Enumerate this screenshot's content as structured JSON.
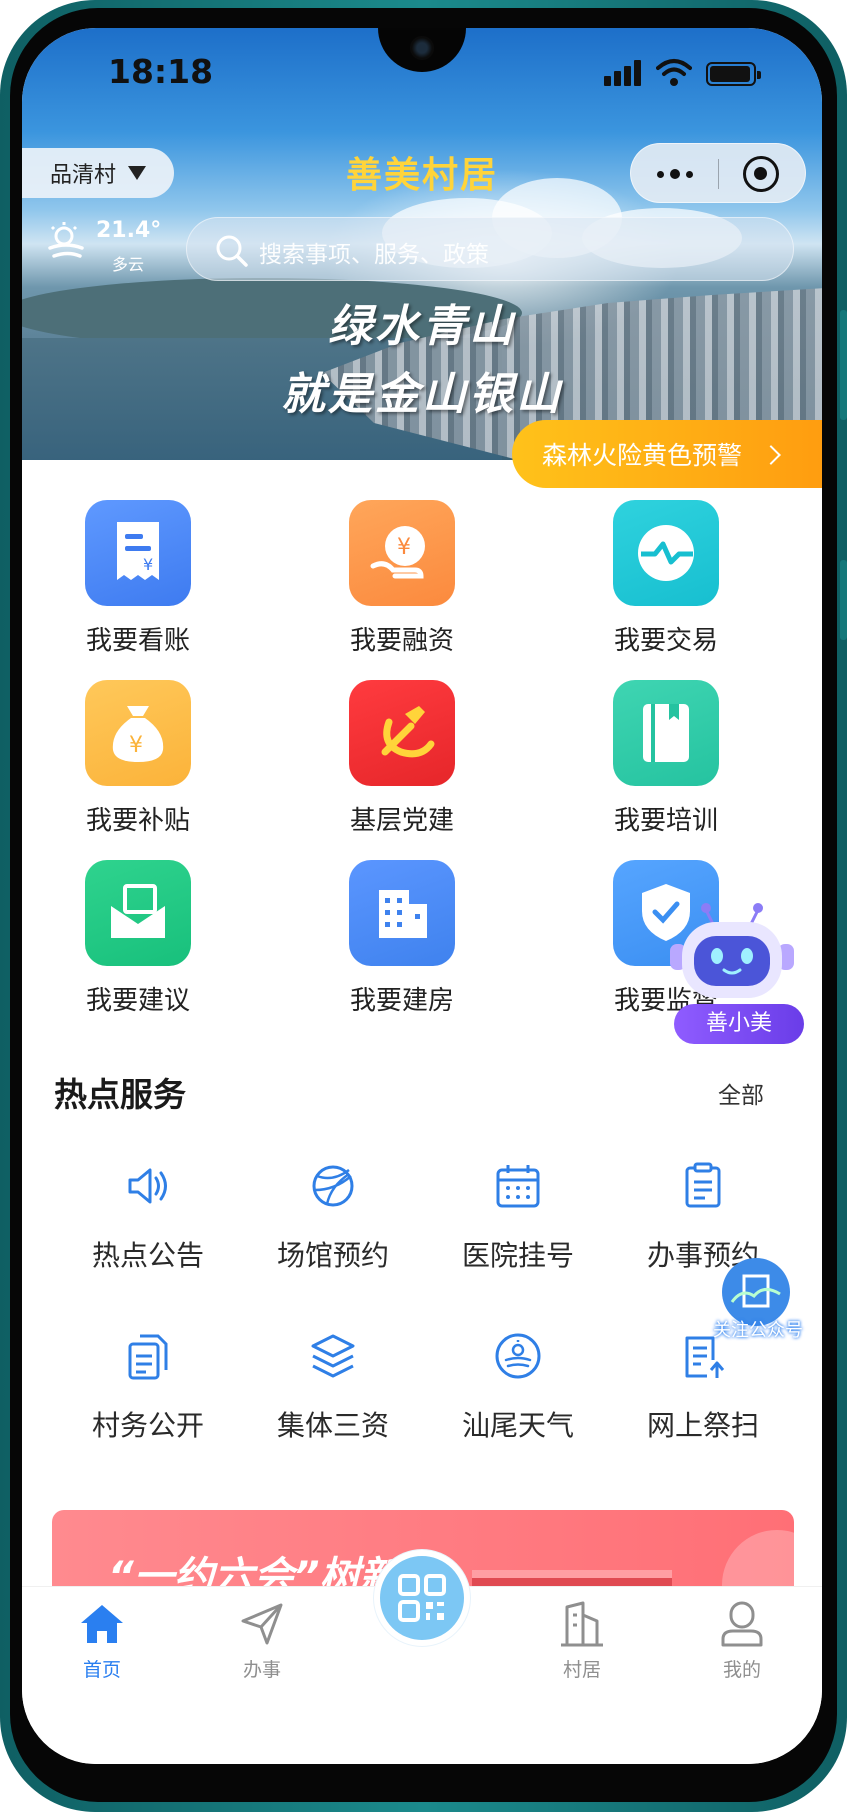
{
  "status_bar": {
    "time": "18:18"
  },
  "header": {
    "village_selector": "品清村",
    "title": "善美村居",
    "weather": {
      "temperature": "21.4°",
      "description": "多云"
    },
    "search": {
      "placeholder": "搜索事项、服务、政策"
    },
    "banner_slogan": [
      "绿水青山",
      "就是金山银山"
    ],
    "alert": "森林火险黄色预警"
  },
  "quick_services": [
    {
      "label": "我要看账",
      "icon": "receipt-yuan-icon",
      "color": "#3e7bf0"
    },
    {
      "label": "我要融资",
      "icon": "yuan-hand-icon",
      "color": "#fb8a3e"
    },
    {
      "label": "我要交易",
      "icon": "exchange-icon",
      "color": "#17bfd0"
    },
    {
      "label": "我要补贴",
      "icon": "money-bag-icon",
      "color": "#fbb33a"
    },
    {
      "label": "基层党建",
      "icon": "party-emblem-icon",
      "color": "#e6262a"
    },
    {
      "label": "我要培训",
      "icon": "book-icon",
      "color": "#25c3a0"
    },
    {
      "label": "我要建议",
      "icon": "mail-icon",
      "color": "#18c07c"
    },
    {
      "label": "我要建房",
      "icon": "building-icon",
      "color": "#3f82ee"
    },
    {
      "label": "我要监督",
      "icon": "shield-check-icon",
      "color": "#3b8ff2"
    }
  ],
  "hot_section": {
    "title": "热点服务",
    "more": "全部",
    "items": [
      {
        "label": "热点公告",
        "icon": "speaker-icon"
      },
      {
        "label": "场馆预约",
        "icon": "basketball-icon"
      },
      {
        "label": "医院挂号",
        "icon": "calendar-icon"
      },
      {
        "label": "办事预约",
        "icon": "clipboard-icon"
      },
      {
        "label": "村务公开",
        "icon": "documents-icon"
      },
      {
        "label": "集体三资",
        "icon": "layers-icon"
      },
      {
        "label": "汕尾天气",
        "icon": "weather-icon"
      },
      {
        "label": "网上祭扫",
        "icon": "upload-list-icon"
      }
    ],
    "accent": "#2f7fe6"
  },
  "promo_banner": {
    "title": "“一约六会”树新风"
  },
  "assistant": {
    "label": "善小美"
  },
  "follow": {
    "label": "关注公众号"
  },
  "tabs": [
    {
      "label": "首页",
      "icon": "home-icon",
      "active": true
    },
    {
      "label": "办事",
      "icon": "send-icon",
      "active": false
    },
    {
      "label": "",
      "icon": "qr-code-icon",
      "active": false
    },
    {
      "label": "村居",
      "icon": "building-outline-icon",
      "active": false
    },
    {
      "label": "我的",
      "icon": "user-icon",
      "active": false
    }
  ],
  "colors": {
    "primary": "#2a7ff0",
    "title_yellow": "#ffd43a",
    "alert_orange": "#ffab14",
    "assistant_purple": "#7a4df0"
  }
}
